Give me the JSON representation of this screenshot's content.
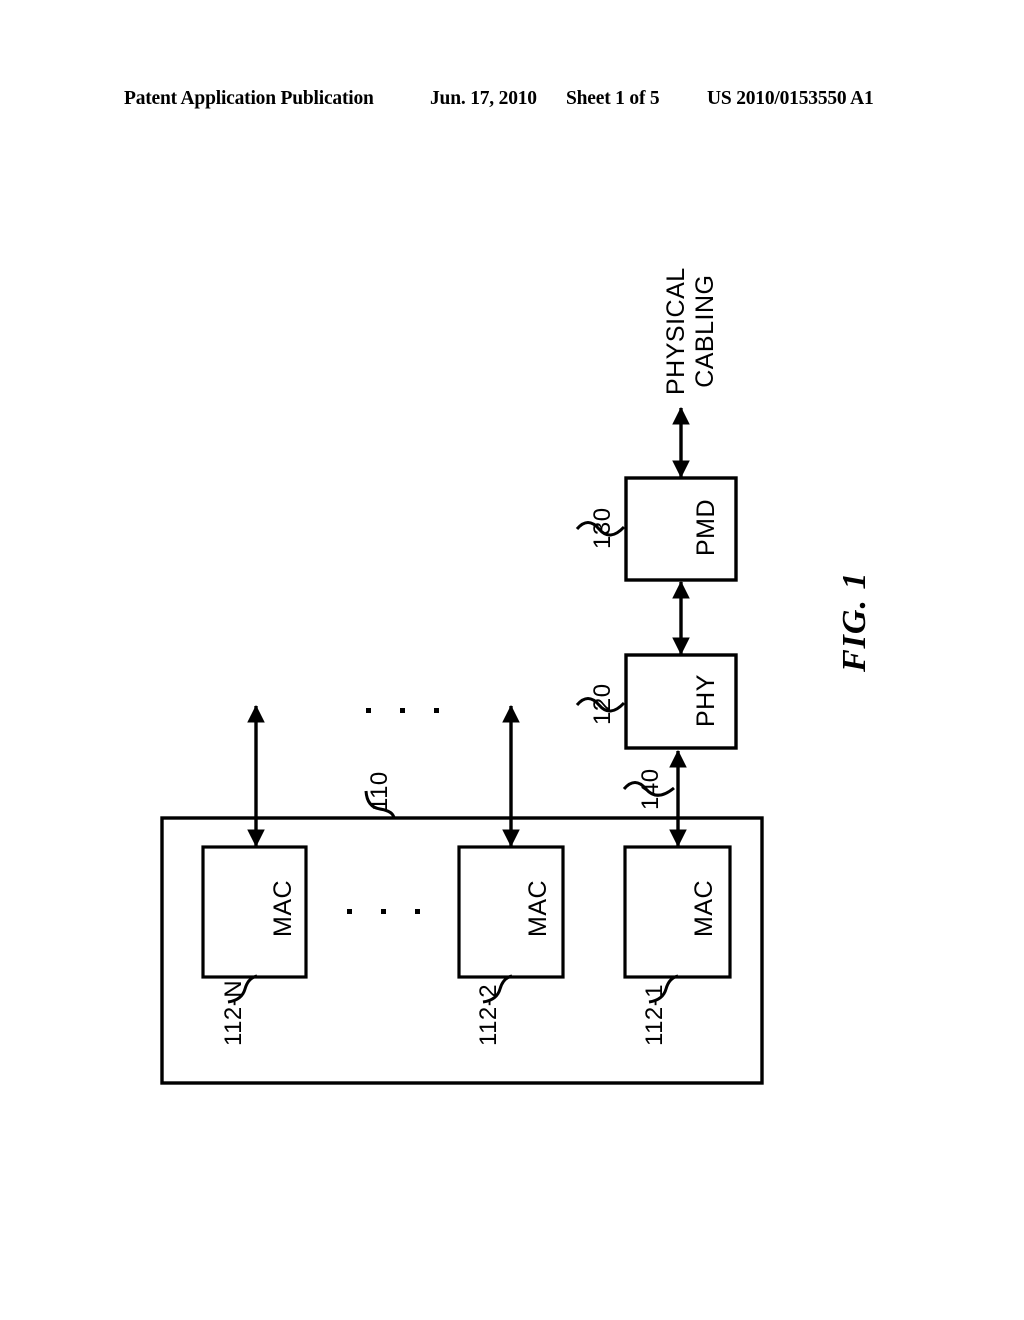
{
  "header": {
    "publication": "Patent Application Publication",
    "date": "Jun. 17, 2010",
    "sheet": "Sheet 1 of 5",
    "patent_number": "US 2010/0153550 A1"
  },
  "figure": {
    "caption": "FIG. 1",
    "external_label_line1": "PHYSICAL",
    "external_label_line2": "CABLING",
    "blocks": [
      {
        "id": "pmd",
        "label": "PMD",
        "ref": "130"
      },
      {
        "id": "phy",
        "label": "PHY",
        "ref": "120"
      },
      {
        "id": "mac1",
        "label": "MAC",
        "ref": "112-1"
      },
      {
        "id": "mac2",
        "label": "MAC",
        "ref": "112-2"
      },
      {
        "id": "macn",
        "label": "MAC",
        "ref": "112-N"
      }
    ],
    "container": {
      "id": "controller",
      "ref": "110"
    },
    "connections": [
      {
        "id": "phy-to-mac1",
        "ref": "140"
      }
    ],
    "ellipsis": "..."
  }
}
